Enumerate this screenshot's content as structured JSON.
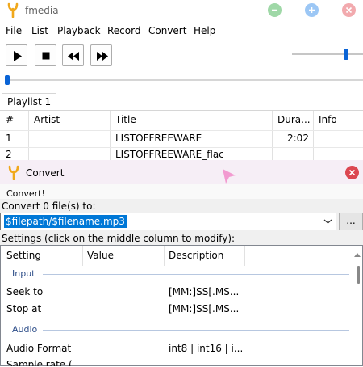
{
  "window": {
    "title": "fmedia"
  },
  "menu": [
    "File",
    "List",
    "Playback",
    "Record",
    "Convert",
    "Help"
  ],
  "playlist": {
    "tab": "Playlist 1",
    "columns": [
      "#",
      "Artist",
      "Title",
      "Dura...",
      "Info"
    ],
    "rows": [
      {
        "num": "1",
        "artist": "",
        "title": "LISTOFFREEWARE",
        "duration": "2:02",
        "info": ""
      },
      {
        "num": "2",
        "artist": "",
        "title": "LISTOFFREEWARE_flac",
        "duration": "",
        "info": ""
      }
    ]
  },
  "convert_dialog": {
    "title": "Convert",
    "convert_label": "Convert!",
    "count_label": "Convert 0 file(s) to:",
    "output_path": "$filepath/$filename.mp3",
    "browse": "...",
    "settings_label": "Settings (click on the middle column to modify):",
    "settings_columns": [
      "Setting",
      "Value",
      "Description"
    ],
    "groups": {
      "input": "Input",
      "audio": "Audio"
    },
    "rows": [
      {
        "setting": "Seek to",
        "value": "",
        "description": "[MM:]SS[.MS..."
      },
      {
        "setting": "Stop at",
        "value": "",
        "description": "[MM:]SS[.MS..."
      },
      {
        "setting": "Audio Format",
        "value": "",
        "description": "int8 | int16 | i..."
      },
      {
        "setting": "Sample rate (",
        "value": "",
        "description": ""
      }
    ]
  },
  "colors": {
    "accent": "#0a64d6",
    "logo": "#f0a81c",
    "dialog_close": "#dc4751"
  }
}
